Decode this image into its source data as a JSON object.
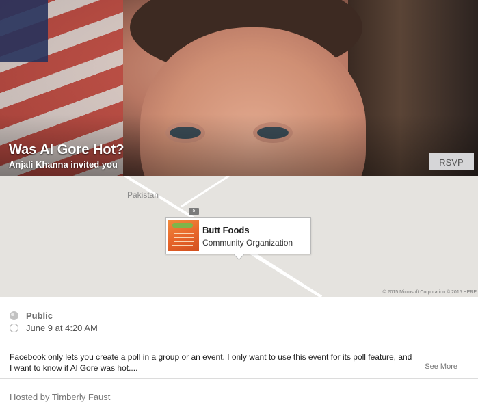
{
  "event": {
    "title": "Was Al Gore Hot?",
    "invited_by": "Anjali Khanna invited you",
    "rsvp_label": "RSVP"
  },
  "map": {
    "region_label": "Pakistan",
    "road_badge": "5",
    "place": {
      "name": "Butt Foods",
      "category": "Community Organization"
    },
    "copyright": "© 2015 Microsoft Corporation © 2015 HERE"
  },
  "info": {
    "privacy": "Public",
    "datetime": "June 9 at 4:20 AM"
  },
  "description": {
    "text": "Facebook only lets you create a poll in a group or an event. I only want to use this event for its poll feature, and I want to know if Al Gore was hot....",
    "see_more": "See More"
  },
  "host": {
    "text": "Hosted by Timberly Faust"
  },
  "colors": {
    "map_bg": "#e5e3df",
    "rsvp_bg": "#d6d6d8",
    "divider": "#dcdcdc"
  }
}
